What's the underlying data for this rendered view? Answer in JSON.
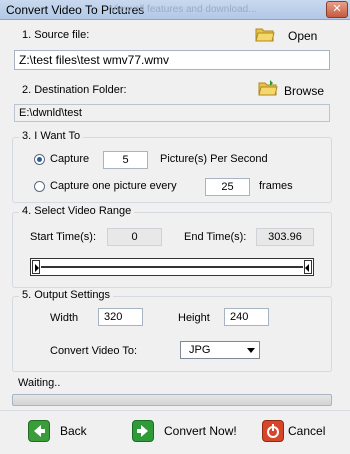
{
  "window": {
    "title": "Convert Video To Pictures",
    "watermark": "View all features and download...",
    "close_label": "✕"
  },
  "source": {
    "heading": "1. Source file:",
    "open_label": "Open",
    "path": "Z:\\test files\\test wmv77.wmv"
  },
  "destination": {
    "heading": "2. Destination Folder:",
    "browse_label": "Browse",
    "path": "E:\\dwnld\\test"
  },
  "want": {
    "heading": "3. I Want To",
    "capture_label": "Capture",
    "capture_value": "5",
    "capture_suffix": "Picture(s) Per Second",
    "every_label": "Capture one picture every",
    "every_value": "25",
    "every_suffix": "frames",
    "selected": "capture"
  },
  "range": {
    "heading": "4. Select Video Range",
    "start_label": "Start Time(s):",
    "start_value": "0",
    "end_label": "End Time(s):",
    "end_value": "303.96"
  },
  "output": {
    "heading": "5. Output Settings",
    "width_label": "Width",
    "width_value": "320",
    "height_label": "Height",
    "height_value": "240",
    "convert_label": "Convert Video To:",
    "format": "JPG"
  },
  "status": {
    "text": "Waiting..",
    "progress": 0
  },
  "buttons": {
    "back": "Back",
    "convert": "Convert Now!",
    "cancel": "Cancel"
  },
  "colors": {
    "back_icon": "#3a9d3a",
    "convert_icon": "#2e9a38",
    "cancel_icon": "#d8462a"
  }
}
